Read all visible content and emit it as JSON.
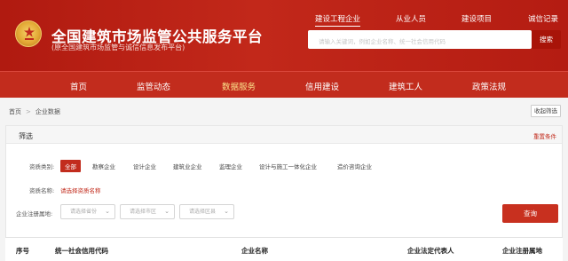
{
  "header": {
    "title": "全国建筑市场监管公共服务平台",
    "subtitle": "(原全国建筑市场监管与诚信信息发布平台)",
    "top_links": [
      "建设工程企业",
      "从业人员",
      "建设项目",
      "诚信记录"
    ],
    "search_placeholder": "请输入关键词，例如企业名称、统一社会信用代码",
    "search_button": "搜索"
  },
  "main_nav": {
    "items": [
      "首页",
      "监管动态",
      "数据服务",
      "信用建设",
      "建筑工人",
      "政策法规"
    ],
    "active": "数据服务"
  },
  "breadcrumb": [
    "首页",
    "企业数据"
  ],
  "collapse_button": "收起筛选",
  "filter": {
    "title": "筛选",
    "reset": "重置条件",
    "qualification_type_label": "资质类别:",
    "qualification_types": [
      "全部",
      "勘察企业",
      "设计企业",
      "建筑业企业",
      "监理企业",
      "设计与施工一体化企业",
      "造价咨询企业"
    ],
    "qualification_active": "全部",
    "qualification_name_label": "资质名称:",
    "qualification_name_link": "请选择资质名称",
    "region_label": "企业注册属地:",
    "region_selects": [
      "请选择省份",
      "请选择市区",
      "请选择区县"
    ],
    "query_button": "查询"
  },
  "table": {
    "headers": [
      "序号",
      "统一社会信用代码",
      "企业名称",
      "企业法定代表人",
      "企业注册属地"
    ]
  },
  "colors": {
    "header_red": "#b41c12",
    "nav_red": "#c22c1d",
    "active_nav": "#fbe08a",
    "link_red": "#c22c1d"
  }
}
